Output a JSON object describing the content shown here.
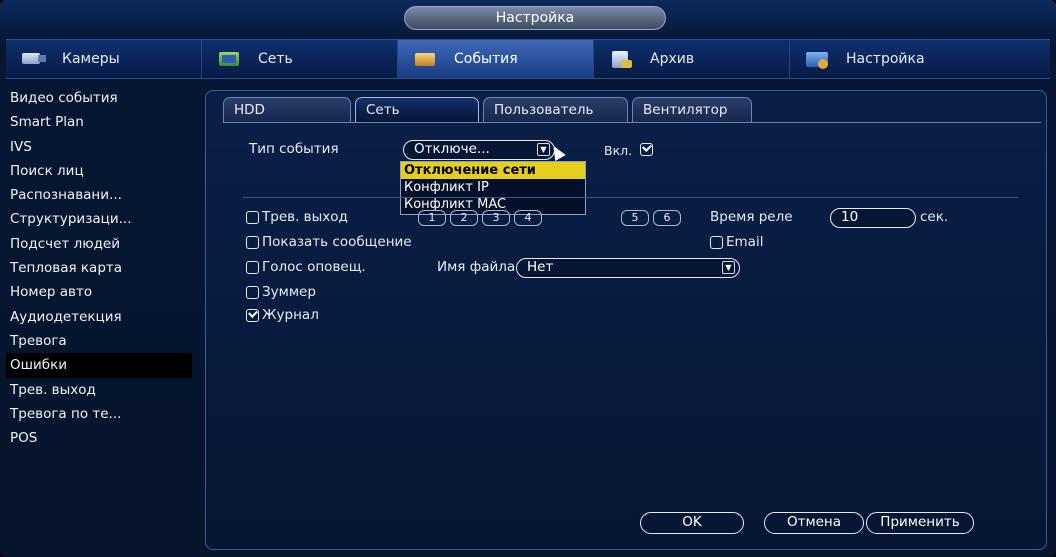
{
  "window": {
    "title": "Настройка"
  },
  "top_tabs": [
    {
      "label": "Камеры",
      "icon": "camera-icon"
    },
    {
      "label": "Сеть",
      "icon": "network-icon"
    },
    {
      "label": "События",
      "icon": "events-icon",
      "active": true
    },
    {
      "label": "Архив",
      "icon": "archive-icon"
    },
    {
      "label": "Настройка",
      "icon": "settings-icon"
    }
  ],
  "sidebar": {
    "items": [
      {
        "label": "Видео события"
      },
      {
        "label": "Smart Plan"
      },
      {
        "label": "IVS"
      },
      {
        "label": "Поиск лиц"
      },
      {
        "label": "Распознавани..."
      },
      {
        "label": "Структуризаци..."
      },
      {
        "label": "Подсчет людей"
      },
      {
        "label": "Тепловая карта"
      },
      {
        "label": "Номер авто"
      },
      {
        "label": "Аудиодетекция"
      },
      {
        "label": "Тревога"
      },
      {
        "label": "Ошибки",
        "active": true
      },
      {
        "label": "Трев. выход"
      },
      {
        "label": "Тревога по те..."
      },
      {
        "label": "POS"
      }
    ]
  },
  "sub_tabs": [
    {
      "label": "HDD"
    },
    {
      "label": "Сеть",
      "active": true
    },
    {
      "label": "Пользователь"
    },
    {
      "label": "Вентилятор"
    }
  ],
  "form": {
    "event_type_label": "Тип события",
    "event_type_value": "Отключе...",
    "enable_label": "Вкл.",
    "enable_checked": true,
    "event_type_options": [
      "Отключение сети",
      "Конфликт IP",
      "Конфликт MAC"
    ],
    "alarm_out_label": "Трев. выход",
    "alarm_out_channels": [
      "1",
      "2",
      "3",
      "4",
      "5",
      "6"
    ],
    "relay_time_label": "Время реле",
    "relay_time_value": "10",
    "relay_time_unit": "сек.",
    "show_message_label": "Показать сообщение",
    "email_label": "Email",
    "voice_label": "Голос оповещ.",
    "file_name_label": "Имя файла",
    "file_name_value": "Нет",
    "buzzer_label": "Зуммер",
    "log_label": "Журнал",
    "log_checked": true
  },
  "buttons": {
    "ok": "OK",
    "cancel": "Отмена",
    "apply": "Применить"
  },
  "colors": {
    "highlight": "#e6cf1c",
    "panel_bg": "#071633",
    "accent": "#3f69b8"
  }
}
